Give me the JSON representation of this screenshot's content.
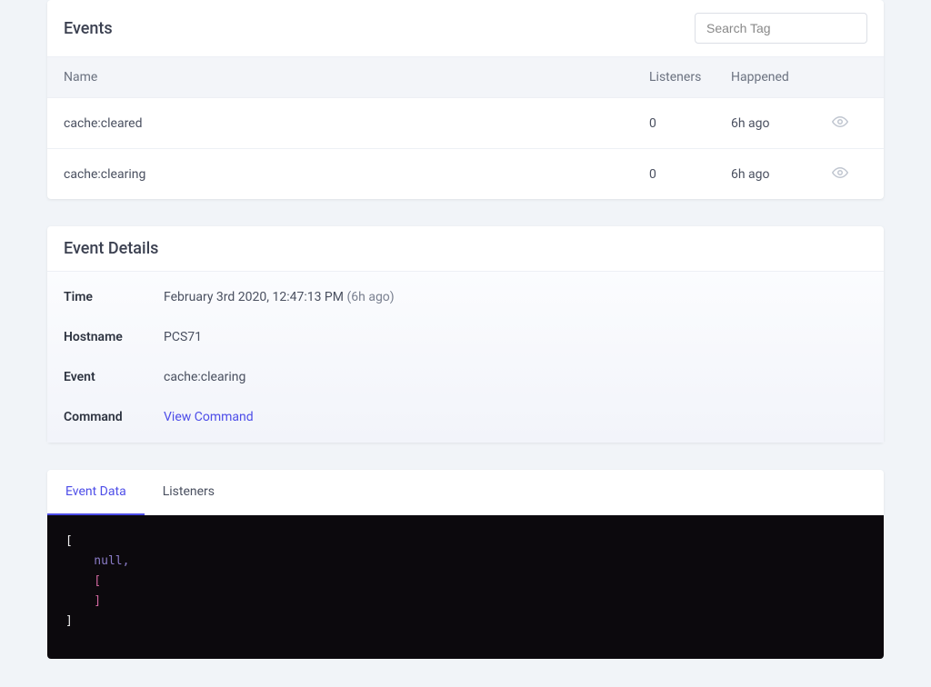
{
  "events_panel": {
    "title": "Events",
    "search_placeholder": "Search Tag",
    "columns": {
      "name": "Name",
      "listeners": "Listeners",
      "happened": "Happened"
    },
    "rows": [
      {
        "name": "cache:cleared",
        "listeners": "0",
        "happened": "6h ago"
      },
      {
        "name": "cache:clearing",
        "listeners": "0",
        "happened": "6h ago"
      }
    ]
  },
  "details_panel": {
    "title": "Event Details",
    "fields": {
      "time_label": "Time",
      "time_value": "February 3rd 2020, 12:47:13 PM",
      "time_relative": "(6h ago)",
      "hostname_label": "Hostname",
      "hostname_value": "PCS71",
      "event_label": "Event",
      "event_value": "cache:clearing",
      "command_label": "Command",
      "command_link": "View Command"
    }
  },
  "tabs_panel": {
    "tabs": [
      {
        "label": "Event Data",
        "active": true
      },
      {
        "label": "Listeners",
        "active": false
      }
    ],
    "code": {
      "open": "[",
      "indent_null": "    null,",
      "indent_open": "    [",
      "indent_close": "    ]",
      "close": "]"
    }
  }
}
